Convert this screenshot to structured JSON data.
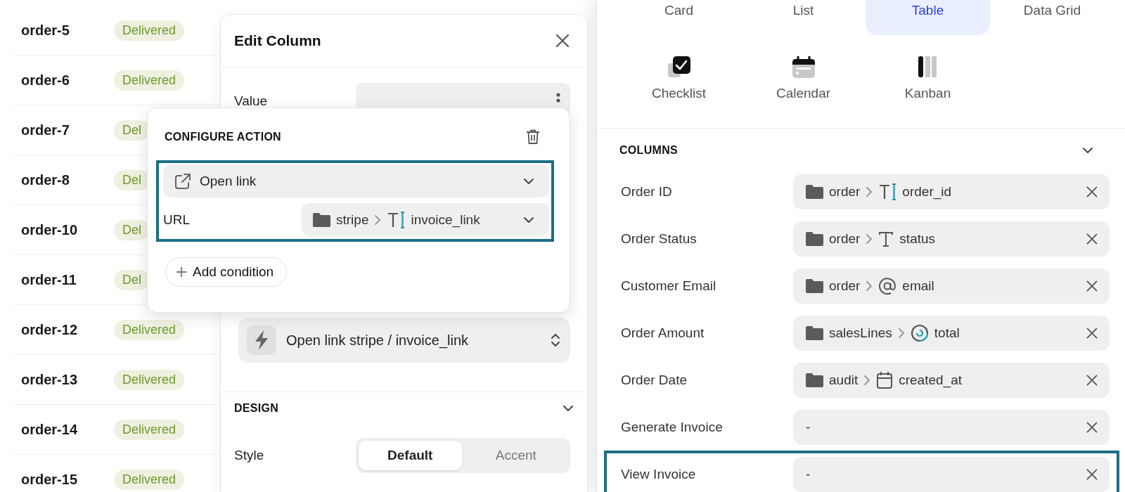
{
  "orders": [
    {
      "id": "order-5",
      "status": "Delivered"
    },
    {
      "id": "order-6",
      "status": "Delivered"
    },
    {
      "id": "order-7",
      "status": "Del"
    },
    {
      "id": "order-8",
      "status": "Del"
    },
    {
      "id": "order-10",
      "status": "Del"
    },
    {
      "id": "order-11",
      "status": "Del"
    },
    {
      "id": "order-12",
      "status": "Delivered"
    },
    {
      "id": "order-13",
      "status": "Delivered"
    },
    {
      "id": "order-14",
      "status": "Delivered"
    },
    {
      "id": "order-15",
      "status": "Delivered"
    }
  ],
  "edit_column": {
    "title": "Edit Column",
    "value": {
      "label": "Value"
    },
    "action": {
      "text": "Open link stripe / invoice_link"
    },
    "design": {
      "title": "DESIGN",
      "expanded": true
    },
    "style": {
      "label": "Style",
      "options": [
        {
          "label": "Default",
          "selected": true
        },
        {
          "label": "Accent",
          "selected": false
        }
      ]
    }
  },
  "configure_action": {
    "title": "CONFIGURE ACTION",
    "highlighted": true,
    "action": {
      "label": "Open link"
    },
    "url": {
      "label": "URL",
      "source": "stripe",
      "field": "invoice_link",
      "kind": "text_input"
    },
    "add_condition": "Add condition"
  },
  "views": {
    "tabs": [
      {
        "label": "Card",
        "selected": false
      },
      {
        "label": "List",
        "selected": false
      },
      {
        "label": "Table",
        "selected": true
      },
      {
        "label": "Data Grid",
        "selected": false
      }
    ],
    "options": [
      {
        "label": "Checklist",
        "kind": "checklist",
        "selected": false
      },
      {
        "label": "Calendar",
        "kind": "calendar",
        "selected": false
      },
      {
        "label": "Kanban",
        "kind": "kanban",
        "selected": false
      }
    ]
  },
  "columns": {
    "title": "COLUMNS",
    "expanded": true,
    "rows": [
      {
        "label": "Order ID",
        "source": "order",
        "field": "order_id",
        "kind": "text_input",
        "highlighted": false
      },
      {
        "label": "Order Status",
        "source": "order",
        "field": "status",
        "kind": "text",
        "highlighted": false
      },
      {
        "label": "Customer Email",
        "source": "order",
        "field": "email",
        "kind": "email",
        "highlighted": false
      },
      {
        "label": "Order Amount",
        "source": "salesLines",
        "field": "total",
        "kind": "number",
        "highlighted": false
      },
      {
        "label": "Order Date",
        "source": "audit",
        "field": "created_at",
        "kind": "date",
        "highlighted": false
      },
      {
        "label": "Generate Invoice",
        "value": "-",
        "highlighted": false
      },
      {
        "label": "View Invoice",
        "value": "-",
        "highlighted": true
      }
    ]
  }
}
